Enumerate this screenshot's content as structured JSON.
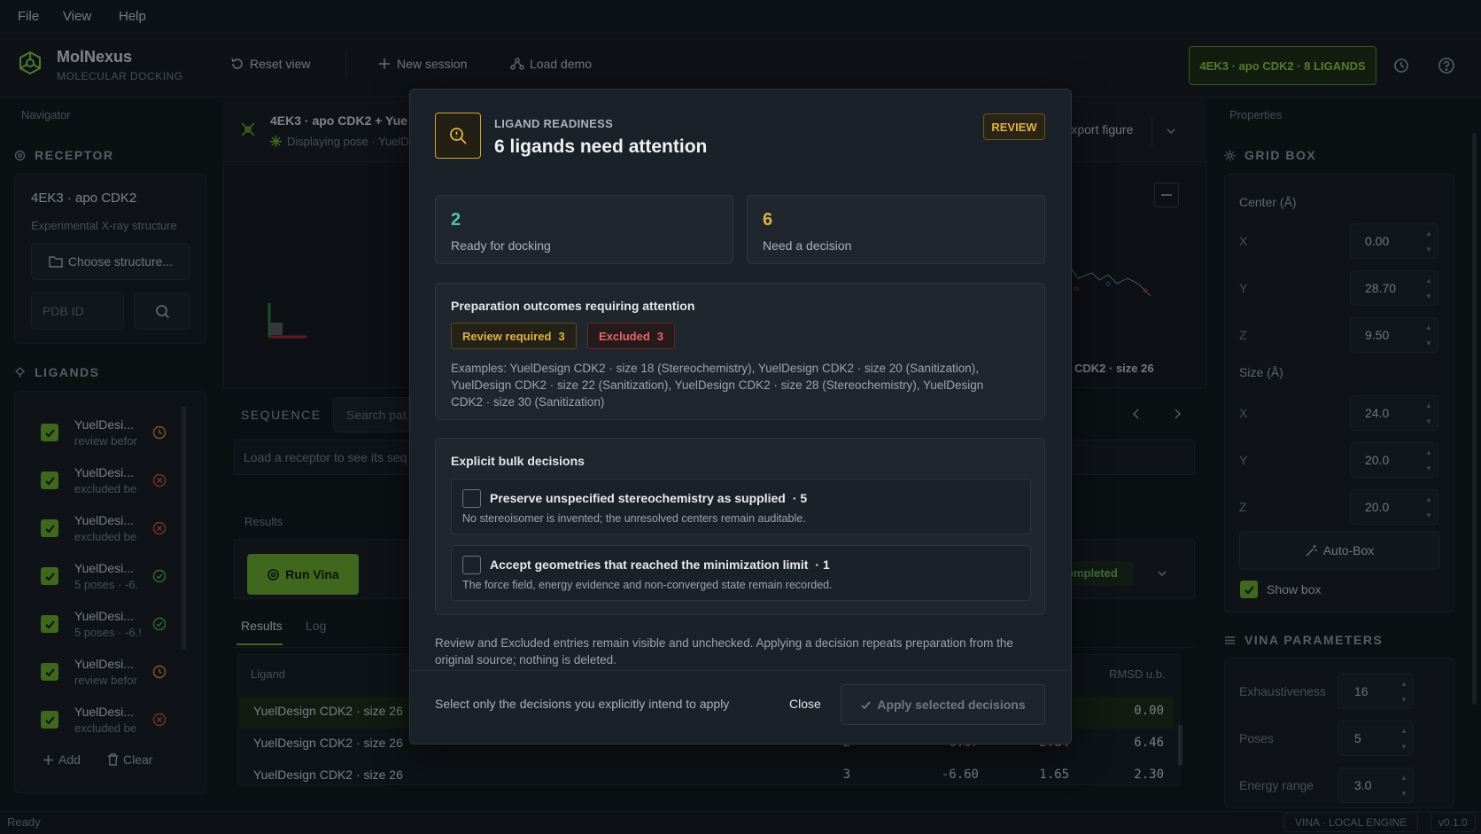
{
  "menu": [
    "File",
    "View",
    "Help"
  ],
  "brand": {
    "name": "MolNexus",
    "subtitle": "MOLECULAR DOCKING"
  },
  "toolbar": {
    "reset": "Reset view",
    "new_session": "New session",
    "load_demo": "Load demo",
    "session_pill": "4EK3 · apo CDK2 · 8 LIGANDS"
  },
  "navigator": {
    "title": "Navigator",
    "receptor_title": "RECEPTOR",
    "receptor_name": "4EK3 · apo CDK2",
    "receptor_desc": "Experimental X-ray structure",
    "choose_structure": "Choose structure...",
    "pdb_placeholder": "PDB ID",
    "ligands_title": "LIGANDS",
    "ligands": [
      {
        "name": "YuelDesi...",
        "sub": "review befor",
        "status": "clock-icon",
        "color": "#d3a23a"
      },
      {
        "name": "YuelDesi...",
        "sub": "excluded be",
        "status": "x-circle-icon",
        "color": "#d9534f"
      },
      {
        "name": "YuelDesi...",
        "sub": "excluded be",
        "status": "x-circle-icon",
        "color": "#d9534f"
      },
      {
        "name": "YuelDesi...",
        "sub": "5 poses · -6.",
        "status": "check-circle-icon",
        "color": "#5cb85c"
      },
      {
        "name": "YuelDesi...",
        "sub": "5 poses · -6.!",
        "status": "check-circle-icon",
        "color": "#5cb85c"
      },
      {
        "name": "YuelDesi...",
        "sub": "review befor",
        "status": "clock-icon",
        "color": "#d3a23a"
      },
      {
        "name": "YuelDesi...",
        "sub": "excluded be",
        "status": "x-circle-icon",
        "color": "#d9534f"
      }
    ],
    "add": "Add",
    "clear": "Clear"
  },
  "viewer": {
    "title": "4EK3 · apo CDK2 + Yue",
    "subtitle": "Displaying pose · YuelD",
    "export": "Export figure",
    "overlay_label": "CDK2 · size 26"
  },
  "sequence": {
    "title": "SEQUENCE",
    "search_placeholder": "Search pat",
    "empty": "Load a receptor to see its seq"
  },
  "results": {
    "section": "Results",
    "run": "Run Vina",
    "status": "ompleted",
    "tabs": [
      "Results",
      "Log"
    ],
    "col_ligand": "Ligand",
    "col_rmsd": "RMSD u.b.",
    "rows": [
      {
        "ligand": "YuelDesign CDK2 · size 26",
        "mode": "",
        "affinity": "",
        "lb": "",
        "ub": "0.00"
      },
      {
        "ligand": "YuelDesign CDK2 · size 26",
        "mode": "2",
        "affinity": "-6.67",
        "lb": "2.84",
        "ub": "6.46"
      },
      {
        "ligand": "YuelDesign CDK2 · size 26",
        "mode": "3",
        "affinity": "-6.60",
        "lb": "1.65",
        "ub": "2.30"
      }
    ]
  },
  "properties": {
    "title": "Properties",
    "grid_title": "GRID BOX",
    "center_label": "Center (Å)",
    "size_label": "Size (Å)",
    "center": {
      "x": "0.00",
      "y": "28.70",
      "z": "9.50"
    },
    "size": {
      "x": "24.0",
      "y": "20.0",
      "z": "20.0"
    },
    "axis": [
      "X",
      "Y",
      "Z"
    ],
    "autobox": "Auto-Box",
    "show_box": "Show box",
    "vina_title": "VINA PARAMETERS",
    "exhaustiveness_label": "Exhaustiveness",
    "exhaustiveness": "16",
    "poses_label": "Poses",
    "poses": "5",
    "energy_label": "Energy range",
    "energy": "3.0"
  },
  "status": {
    "left": "Ready",
    "engine": "VINA · LOCAL ENGINE",
    "version": "v0.1.0"
  },
  "modal": {
    "eyebrow": "LIGAND READINESS",
    "title": "6 ligands need attention",
    "badge": "REVIEW",
    "ready_count": "2",
    "ready_label": "Ready for docking",
    "decision_count": "6",
    "decision_label": "Need a decision",
    "outcomes_title": "Preparation outcomes requiring attention",
    "review_chip": "Review required",
    "review_count": "3",
    "excluded_chip": "Excluded",
    "excluded_count": "3",
    "examples": "Examples: YuelDesign CDK2 · size 18 (Stereochemistry), YuelDesign CDK2 · size 20 (Sanitization), YuelDesign CDK2 · size 22 (Sanitization), YuelDesign CDK2 · size 28 (Stereochemistry), YuelDesign CDK2 · size 30 (Sanitization)",
    "bulk_title": "Explicit bulk decisions",
    "opt1_title": "Preserve unspecified stereochemistry as supplied",
    "opt1_count": "· 5",
    "opt1_desc": "No stereoisomer is invented; the unresolved centers remain auditable.",
    "opt2_title": "Accept geometries that reached the minimization limit",
    "opt2_count": "· 1",
    "opt2_desc": "The force field, energy evidence and non-converged state remain recorded.",
    "footnote": "Review and Excluded entries remain visible and unchecked. Applying a decision repeats preparation from the original source; nothing is deleted.",
    "hint": "Select only the decisions you explicitly intend to apply",
    "close": "Close",
    "apply": "Apply selected decisions"
  }
}
